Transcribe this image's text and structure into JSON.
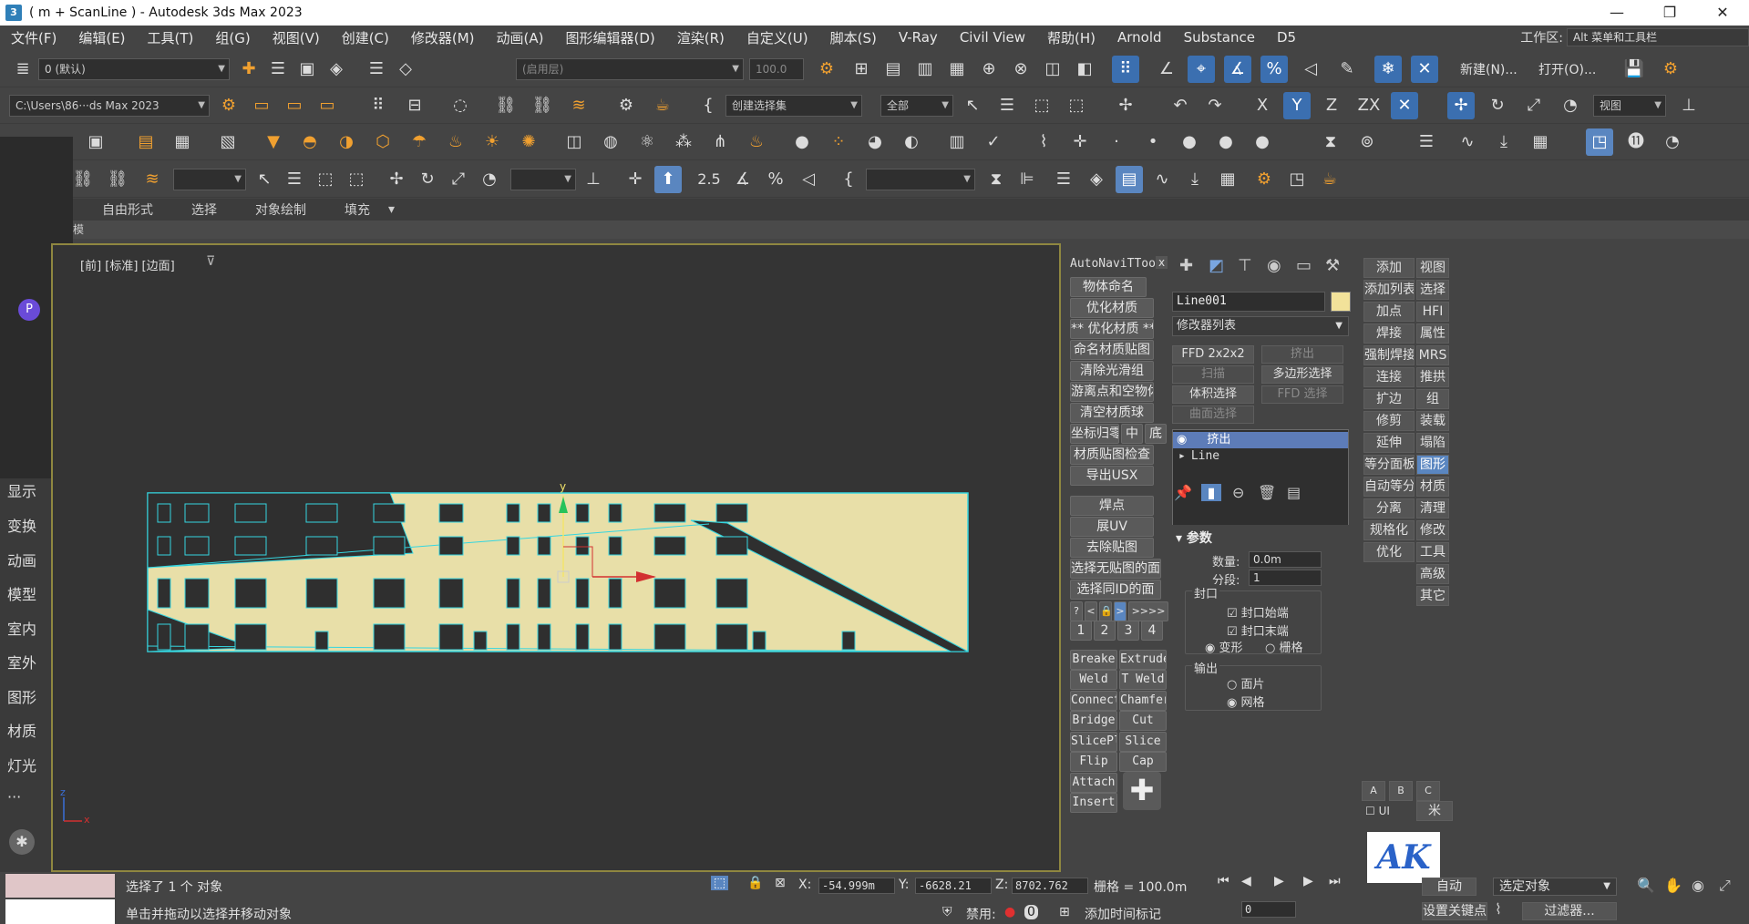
{
  "window": {
    "title": "( m + ScanLine ) - Autodesk 3ds Max 2023",
    "app_icon": "3",
    "controls": [
      "—",
      "❐",
      "✕"
    ]
  },
  "menu": {
    "items": [
      "文件(F)",
      "编辑(E)",
      "工具(T)",
      "组(G)",
      "视图(V)",
      "创建(C)",
      "修改器(M)",
      "动画(A)",
      "图形编辑器(D)",
      "渲染(R)",
      "自定义(U)",
      "脚本(S)",
      "V-Ray",
      "Civil View",
      "帮助(H)",
      "Arnold",
      "Substance",
      "D5"
    ],
    "workspace_label": "工作区:",
    "workspace_value": "Alt 菜单和工具栏"
  },
  "toolbar1": {
    "layer_value": "0 (默认)",
    "disabled_combo": "(启用层)",
    "percent": "100.0",
    "new_label": "新建(N)...",
    "open_label": "打开(O)..."
  },
  "toolbar2": {
    "path": "C:\\Users\\86···ds Max 2023",
    "selection_set": "创建选择集",
    "filter": "全部",
    "view": "视图",
    "axes": [
      "X",
      "Y",
      "Z",
      "ZX"
    ]
  },
  "toolbar4": {
    "snap_value": "2.5"
  },
  "ribbon": {
    "tabs": [
      "自由形式",
      "选择",
      "对象绘制",
      "填充"
    ],
    "sub_label": "模"
  },
  "leftpanel": {
    "p_icon": "P",
    "expand": "≫",
    "items": [
      "显示",
      "变换",
      "动画",
      "模型",
      "室内",
      "室外",
      "图形",
      "材质",
      "灯光",
      "···"
    ],
    "settings_icon": "✱"
  },
  "viewport": {
    "label": "[前] [标准] [边面]",
    "axis_y": "y",
    "axis_x": "x",
    "axis_z": "z"
  },
  "navpanel": {
    "header": "AutoNaviTToo",
    "close": "x",
    "buttons": [
      "物体命名",
      "优化材质",
      "** 优化材质 **",
      "命名材质贴图",
      "清除光滑组",
      "游离点和空物体",
      "清空材质球",
      "坐标归零",
      "材质贴图检查",
      "导出USX",
      "焊点",
      "展UV",
      "去除贴图",
      "选择无贴图的面",
      "选择同ID的面"
    ],
    "coord_sub": [
      "中",
      "底"
    ],
    "small_row": [
      "?",
      "<",
      "🔒",
      ">",
      ">>>>"
    ],
    "numbers": [
      "1",
      "2",
      "3",
      "4"
    ],
    "tools_left": [
      "Breake",
      "Weld",
      "Connect",
      "Bridge",
      "SlicePl",
      "Flip",
      "Attach",
      "Insert"
    ],
    "tools_right": [
      "Extrude",
      "T Weld",
      "Chamfer",
      "Cut",
      "Slice",
      "Cap"
    ]
  },
  "cmdpanel": {
    "object_name": "Line001",
    "object_color": "#f2e29a",
    "modifier_list": "修改器列表",
    "mod_buttons": [
      "FFD 2x2x2",
      "挤出",
      "扫描",
      "多边形选择",
      "体积选择",
      "FFD 选择",
      "曲面选择"
    ],
    "stack": [
      "挤出",
      "Line"
    ],
    "params_title": "参数",
    "amount_label": "数量:",
    "amount_value": "0.0m",
    "segments_label": "分段:",
    "segments_value": "1",
    "capping_label": "封口",
    "cap_start": "封口始端",
    "cap_end": "封口末端",
    "morph": "变形",
    "grid": "栅格",
    "output_label": "输出",
    "patch": "面片",
    "mesh": "网格"
  },
  "rightpanel": {
    "col1": [
      "添加",
      "添加列表",
      "加点",
      "焊接",
      "强制焊接",
      "连接",
      "扩边",
      "修剪",
      "延伸",
      "等分面板",
      "自动等分",
      "分离",
      "规格化",
      "优化"
    ],
    "col2": [
      "视图",
      "选择",
      "HFI",
      "属性",
      "MRS",
      "推拱",
      "组",
      "装载",
      "塌陷",
      "图形",
      "材质",
      "清理",
      "修改",
      "工具",
      "高级",
      "其它"
    ],
    "abc": [
      "A",
      "B",
      "C"
    ],
    "ui_label": "UI",
    "unit": "米"
  },
  "statusbar": {
    "selected": "选择了 1 个 对象",
    "hint": "单击并拖动以选择并移动对象",
    "x_label": "X:",
    "x_value": "-54.999m",
    "y_label": "Y:",
    "y_value": "-6628.21",
    "z_label": "Z:",
    "z_value": "8702.762",
    "grid": "栅格 = 100.0m",
    "disabled": "禁用:",
    "zero": "0",
    "add_time_tag": "添加时间标记",
    "auto": "自动",
    "selected_object": "选定对象",
    "set_key": "设置关键点",
    "filter": "过滤器...",
    "frame": "0"
  }
}
